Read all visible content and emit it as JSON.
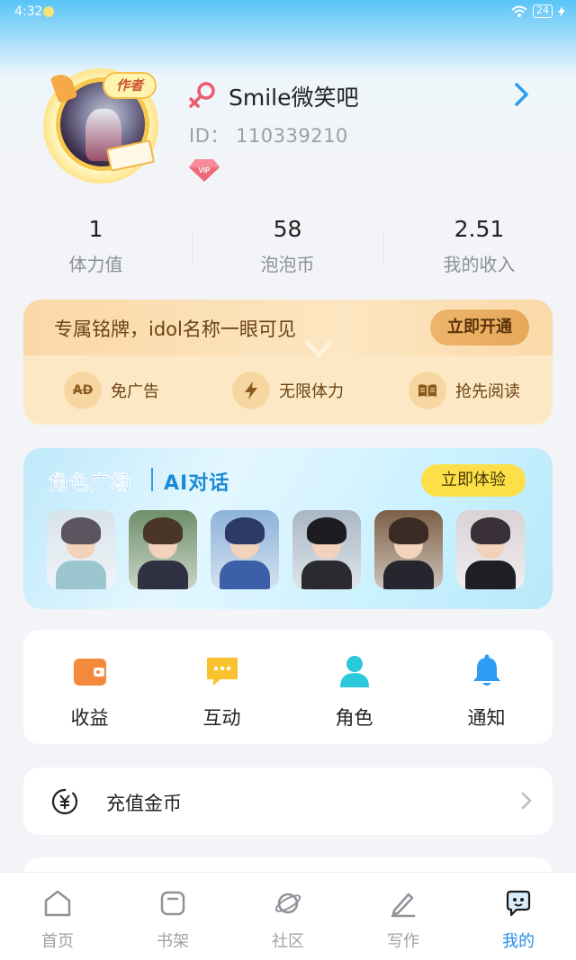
{
  "status_bar": {
    "time": "4:32",
    "battery": "24"
  },
  "profile": {
    "author_badge": "作者",
    "username": "Smile微笑吧",
    "id_text": "ID：  110339210",
    "vip_badge": "VIP"
  },
  "stats": [
    {
      "value": "1",
      "label": "体力值"
    },
    {
      "value": "58",
      "label": "泡泡币"
    },
    {
      "value": "2.51",
      "label": "我的收入"
    }
  ],
  "vip_card": {
    "title": "专属铭牌，idol名称一眼可见",
    "button": "立即开通",
    "perks": [
      {
        "icon": "ad-icon",
        "icon_text": "AD",
        "label": "免广告"
      },
      {
        "icon": "lightning-icon",
        "label": "无限体力"
      },
      {
        "icon": "book-icon",
        "label": "抢先阅读"
      }
    ]
  },
  "ai_card": {
    "title": "角色广场",
    "subtitle": "AI对话",
    "button": "立即体验",
    "characters": [
      {
        "name": "character-1",
        "hair": "#5b5560",
        "body": "#9cc6cf",
        "bg": "#d7e3ea"
      },
      {
        "name": "character-2",
        "hair": "#4a3628",
        "body": "#2f3142",
        "bg": "#6f8f6a"
      },
      {
        "name": "character-3",
        "hair": "#2c3a66",
        "body": "#3d5fa8",
        "bg": "#8db2d8"
      },
      {
        "name": "character-4",
        "hair": "#1c1c22",
        "body": "#2a2a30",
        "bg": "#a9b7c4"
      },
      {
        "name": "character-5",
        "hair": "#3a2c24",
        "body": "#26262e",
        "bg": "#7d5f45"
      },
      {
        "name": "character-6",
        "hair": "#3a3038",
        "body": "#1e1e24",
        "bg": "#d9d2d6"
      }
    ]
  },
  "actions": [
    {
      "icon": "wallet-icon",
      "label": "收益",
      "color": "#f4893c"
    },
    {
      "icon": "chat-icon",
      "label": "互动",
      "color": "#f9c22e"
    },
    {
      "icon": "person-icon",
      "label": "角色",
      "color": "#2ac9dc"
    },
    {
      "icon": "bell-icon",
      "label": "通知",
      "color": "#2e9cf3"
    }
  ],
  "recharge": {
    "icon": "yuan-icon",
    "label": "充值金币"
  },
  "tabs": [
    {
      "icon": "home-icon",
      "label": "首页"
    },
    {
      "icon": "bookshelf-icon",
      "label": "书架"
    },
    {
      "icon": "planet-icon",
      "label": "社区"
    },
    {
      "icon": "pen-icon",
      "label": "写作"
    },
    {
      "icon": "me-icon",
      "label": "我的",
      "active": true
    }
  ],
  "colors": {
    "accent": "#2a8ee6",
    "gender": "#ee5b6e"
  }
}
